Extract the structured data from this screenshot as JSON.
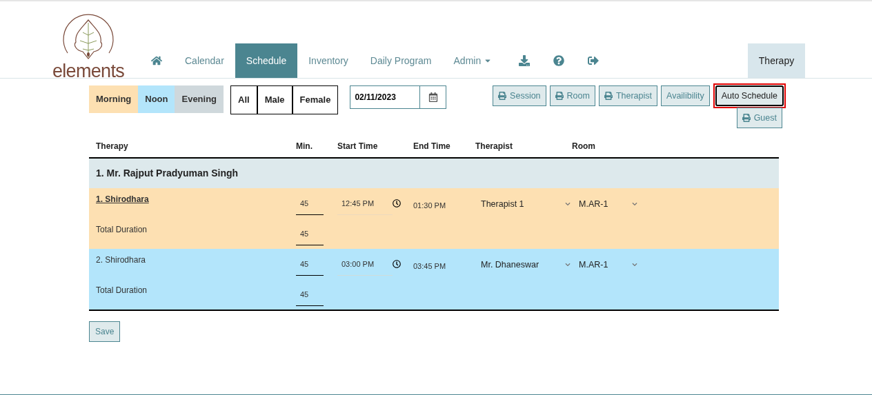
{
  "logo": {
    "text": "elements"
  },
  "nav": [
    {
      "label": "Calendar",
      "selected": false,
      "dropdown": false
    },
    {
      "label": "Schedule",
      "selected": true,
      "dropdown": false
    },
    {
      "label": "Inventory",
      "selected": false,
      "dropdown": false
    },
    {
      "label": "Daily Program",
      "selected": false,
      "dropdown": false
    },
    {
      "label": "Admin",
      "selected": false,
      "dropdown": true
    }
  ],
  "module": "Therapy",
  "shifts": [
    {
      "label": "Morning",
      "color": "#fde0b2"
    },
    {
      "label": "Noon",
      "color": "#b3e5fb"
    },
    {
      "label": "Evening",
      "color": "#cfd8dc"
    }
  ],
  "genders": [
    "All",
    "Male",
    "Female"
  ],
  "date": {
    "value": "02/11/2023"
  },
  "actions": [
    {
      "label": "Session",
      "print": true,
      "highlighted": false
    },
    {
      "label": "Room",
      "print": true,
      "highlighted": false
    },
    {
      "label": "Therapist",
      "print": true,
      "highlighted": false
    },
    {
      "label": "Availibility",
      "print": false,
      "highlighted": false
    },
    {
      "label": "Auto Schedule",
      "print": false,
      "highlighted": true
    },
    {
      "label": "Guest",
      "print": true,
      "highlighted": false
    }
  ],
  "table": {
    "columns": [
      "Therapy",
      "Min.",
      "Start Time",
      "End Time",
      "Therapist",
      "Room"
    ],
    "groups": [
      {
        "guest": "1. Mr. Rajput Pradyuman Singh",
        "therapies": [
          {
            "name": "1. Shirodhara",
            "underlined": true,
            "color": "#fde0b2",
            "minutes": "45",
            "start": "12:45 PM",
            "end": "01:30 PM",
            "therapist": "Therapist 1",
            "room": "M.AR-1",
            "total_label": "Total Duration",
            "total": "45"
          },
          {
            "name": "2. Shirodhara",
            "underlined": false,
            "color": "#b3e5fb",
            "minutes": "45",
            "start": "03:00 PM",
            "end": "03:45 PM",
            "therapist": "Mr. Dhaneswar",
            "room": "M.AR-1",
            "total_label": "Total Duration",
            "total": "45"
          }
        ]
      }
    ]
  },
  "save": "Save"
}
